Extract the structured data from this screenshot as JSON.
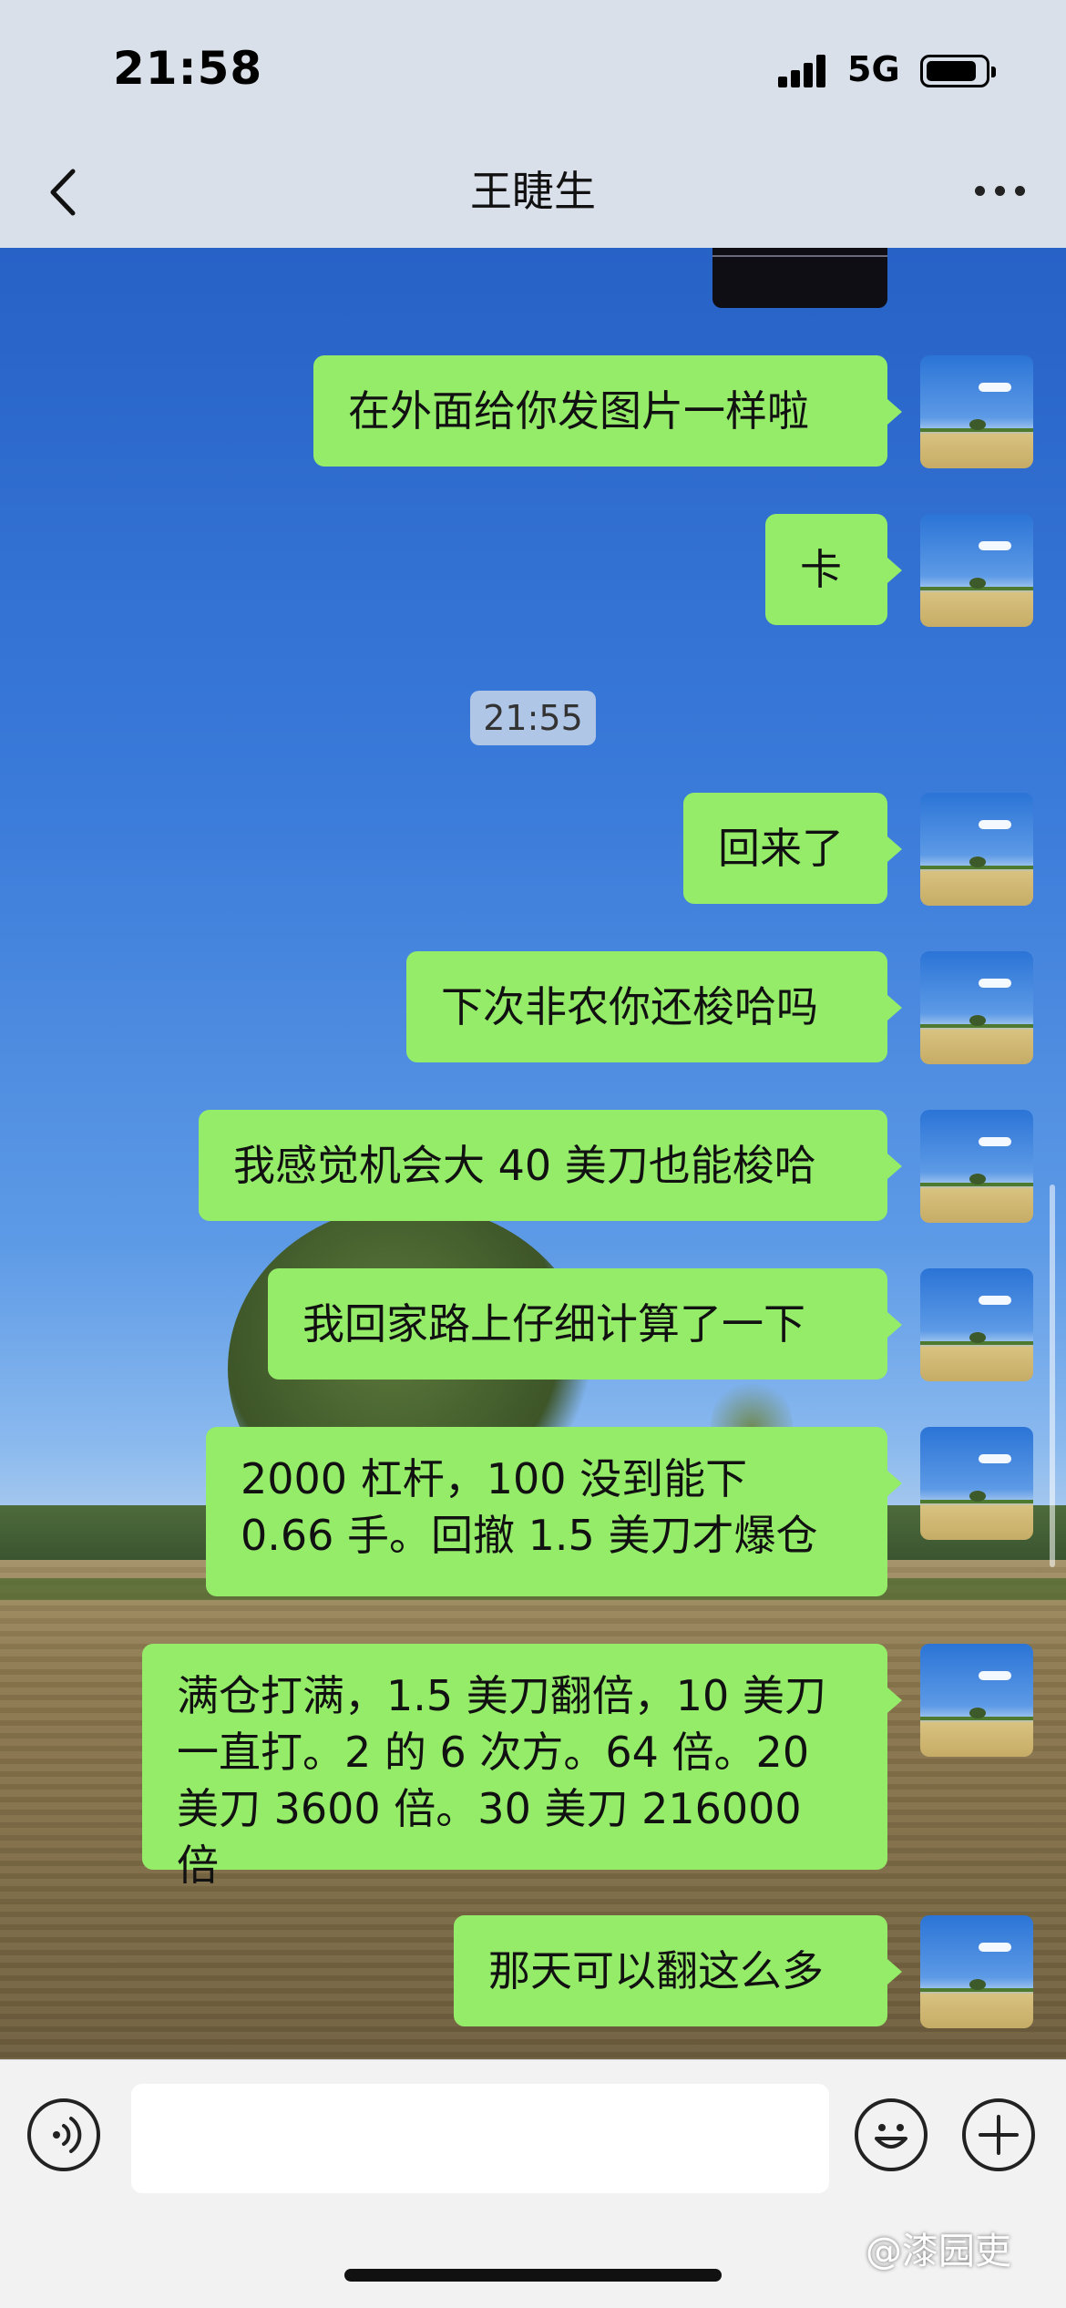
{
  "status_bar": {
    "time": "21:58",
    "network": "5G"
  },
  "header": {
    "title": "王睫生"
  },
  "timestamp": "21:55",
  "messages": [
    {
      "text": "在外面给你发图片一样啦"
    },
    {
      "text": "卡"
    },
    {
      "text": "回来了"
    },
    {
      "text": "下次非农你还梭哈吗"
    },
    {
      "text": "我感觉机会大 40 美刀也能梭哈"
    },
    {
      "text": "我回家路上仔细计算了一下"
    },
    {
      "text": "2000 杠杆，100 没到能下 0.66 手。回撤 1.5 美刀才爆仓"
    },
    {
      "text": "满仓打满，1.5 美刀翻倍，10 美刀一直打。2 的 6 次方。64 倍。20 美刀 3600 倍。30 美刀 216000 倍"
    },
    {
      "text": "那天可以翻这么多"
    }
  ],
  "input": {
    "value": ""
  },
  "watermark": "@漆园吏",
  "colors": {
    "bubble": "#95ec69",
    "bar_bg": "#d9e0ea",
    "input_bg": "#f2f2f2"
  },
  "icons": [
    "back-chevron-icon",
    "more-dots-icon",
    "voice-icon",
    "emoji-icon",
    "plus-icon",
    "signal-icon",
    "battery-icon"
  ]
}
